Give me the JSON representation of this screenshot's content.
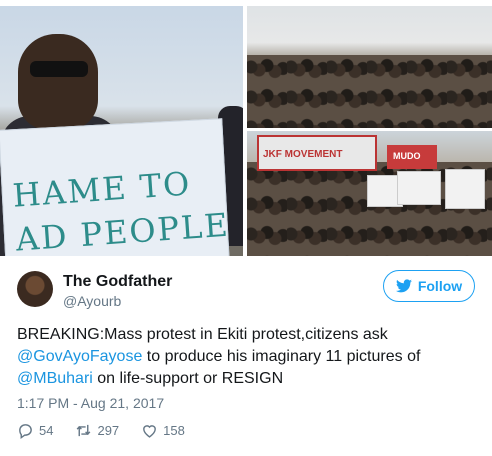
{
  "media": {
    "sign_text": "HAME TO\nAD PEOPLE",
    "banner_text": "JKF MOVEMENT",
    "banner_text_2": "MUDO"
  },
  "tweet": {
    "author_name": "The Godfather",
    "author_handle": "@Ayourb",
    "follow_label": "Follow",
    "text": {
      "part1": "BREAKING:Mass protest in Ekiti protest,citizens ask ",
      "mention1": "@GovAyoFayose",
      "part2": " to produce his imaginary 11 pictures of ",
      "mention2": "@MBuhari",
      "part3": " on life-support or RESIGN"
    },
    "timestamp": "1:17 PM - Aug 21, 2017",
    "replies": "54",
    "retweets": "297",
    "likes": "158"
  },
  "colors": {
    "accent": "#1da1f2",
    "mention": "#1b95e0",
    "secondary_text": "#657786",
    "primary_text": "#14171a"
  },
  "icons": [
    "twitter-bird-icon",
    "reply-icon",
    "retweet-icon",
    "like-icon"
  ]
}
